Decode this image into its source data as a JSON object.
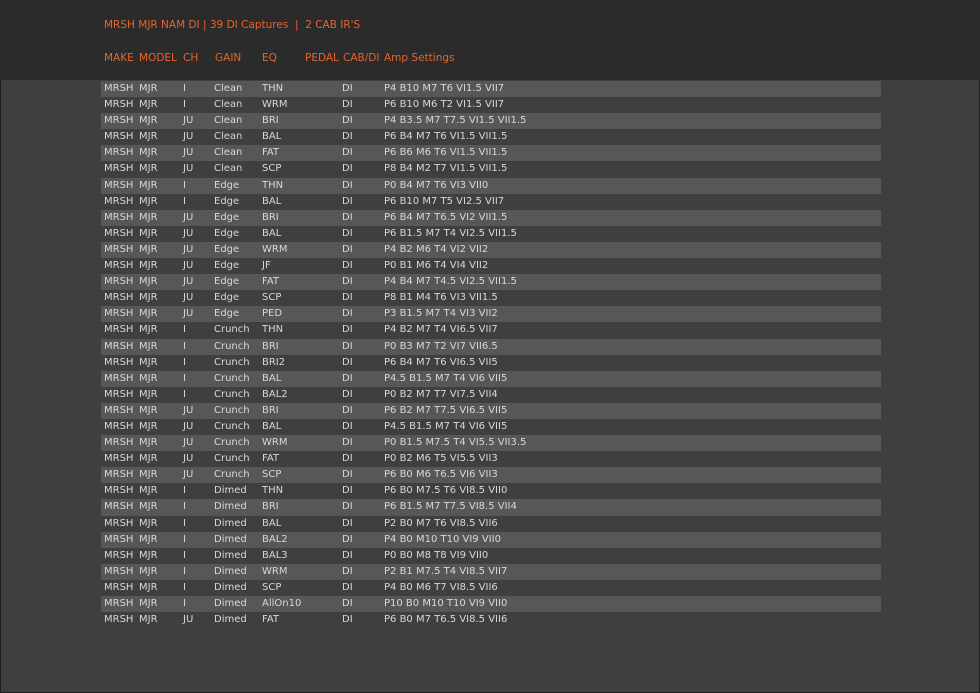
{
  "title": "MRSH MJR NAM DI | 39 DI Captures  |  2 CAB IR'S",
  "columns": {
    "make": "MAKE",
    "model": "MODEL",
    "ch": "CH",
    "gain": "GAIN",
    "eq": "EQ",
    "pedal": "PEDAL",
    "cab": "CAB/DI",
    "amp": "Amp Settings"
  },
  "rows": [
    {
      "make": "MRSH",
      "model": "MJR",
      "ch": "I",
      "gain": "Clean",
      "eq": "THN",
      "cab": "DI",
      "amp": "P4 B10 M7 T6 VI1.5 VII7"
    },
    {
      "make": "MRSH",
      "model": "MJR",
      "ch": "I",
      "gain": "Clean",
      "eq": "WRM",
      "cab": "DI",
      "amp": "P6 B10 M6 T2 VI1.5 VII7"
    },
    {
      "make": "MRSH",
      "model": "MJR",
      "ch": "JU",
      "gain": "Clean",
      "eq": "BRI",
      "cab": "DI",
      "amp": "P4 B3.5 M7 T7.5 VI1.5 VII1.5"
    },
    {
      "make": "MRSH",
      "model": "MJR",
      "ch": "JU",
      "gain": "Clean",
      "eq": "BAL",
      "cab": "DI",
      "amp": "P6 B4 M7 T6 VI1.5 VII1.5"
    },
    {
      "make": "MRSH",
      "model": "MJR",
      "ch": "JU",
      "gain": "Clean",
      "eq": "FAT",
      "cab": "DI",
      "amp": "P6 B6 M6 T6 VI1.5 VII1.5"
    },
    {
      "make": "MRSH",
      "model": "MJR",
      "ch": "JU",
      "gain": "Clean",
      "eq": "SCP",
      "cab": "DI",
      "amp": "P8 B4 M2 T7 VI1.5 VII1.5"
    },
    {
      "make": "MRSH",
      "model": "MJR",
      "ch": "I",
      "gain": "Edge",
      "eq": "THN",
      "cab": "DI",
      "amp": "P0 B4 M7 T6 VI3 VII0"
    },
    {
      "make": "MRSH",
      "model": "MJR",
      "ch": "I",
      "gain": "Edge",
      "eq": "BAL",
      "cab": "DI",
      "amp": "P6 B10 M7 T5 VI2.5 VII7"
    },
    {
      "make": "MRSH",
      "model": "MJR",
      "ch": "JU",
      "gain": "Edge",
      "eq": "BRI",
      "cab": "DI",
      "amp": "P6 B4 M7 T6.5 VI2 VII1.5"
    },
    {
      "make": "MRSH",
      "model": "MJR",
      "ch": "JU",
      "gain": "Edge",
      "eq": "BAL",
      "cab": "DI",
      "amp": "P6 B1.5 M7 T4 VI2.5 VII1.5"
    },
    {
      "make": "MRSH",
      "model": "MJR",
      "ch": "JU",
      "gain": "Edge",
      "eq": "WRM",
      "cab": "DI",
      "amp": "P4 B2 M6 T4 VI2 VII2"
    },
    {
      "make": "MRSH",
      "model": "MJR",
      "ch": "JU",
      "gain": "Edge",
      "eq": "JF",
      "cab": "DI",
      "amp": "P0 B1 M6 T4 VI4 VII2"
    },
    {
      "make": "MRSH",
      "model": "MJR",
      "ch": "JU",
      "gain": "Edge",
      "eq": "FAT",
      "cab": "DI",
      "amp": "P4 B4 M7 T4.5 VI2.5 VII1.5"
    },
    {
      "make": "MRSH",
      "model": "MJR",
      "ch": "JU",
      "gain": "Edge",
      "eq": "SCP",
      "cab": "DI",
      "amp": "P8 B1 M4 T6 VI3 VII1.5"
    },
    {
      "make": "MRSH",
      "model": "MJR",
      "ch": "JU",
      "gain": "Edge",
      "eq": "PED",
      "cab": "DI",
      "amp": "P3 B1.5 M7 T4 VI3 VII2"
    },
    {
      "make": "MRSH",
      "model": "MJR",
      "ch": "I",
      "gain": "Crunch",
      "eq": "THN",
      "cab": "DI",
      "amp": "P4 B2 M7 T4 VI6.5 VII7"
    },
    {
      "make": "MRSH",
      "model": "MJR",
      "ch": "I",
      "gain": "Crunch",
      "eq": "BRI",
      "cab": "DI",
      "amp": "P0 B3 M7 T2 VI7 VII6.5"
    },
    {
      "make": "MRSH",
      "model": "MJR",
      "ch": "I",
      "gain": "Crunch",
      "eq": "BRI2",
      "cab": "DI",
      "amp": "P6 B4 M7 T6 VI6.5 VII5"
    },
    {
      "make": "MRSH",
      "model": "MJR",
      "ch": "I",
      "gain": "Crunch",
      "eq": "BAL",
      "cab": "DI",
      "amp": "P4.5 B1.5 M7 T4 VI6 VII5"
    },
    {
      "make": "MRSH",
      "model": "MJR",
      "ch": "I",
      "gain": "Crunch",
      "eq": "BAL2",
      "cab": "DI",
      "amp": "P0 B2 M7 T7 VI7.5 VII4"
    },
    {
      "make": "MRSH",
      "model": "MJR",
      "ch": "JU",
      "gain": "Crunch",
      "eq": "BRI",
      "cab": "DI",
      "amp": "P6 B2 M7 T7.5 VI6.5 VII5"
    },
    {
      "make": "MRSH",
      "model": "MJR",
      "ch": "JU",
      "gain": "Crunch",
      "eq": "BAL",
      "cab": "DI",
      "amp": "P4.5 B1.5 M7 T4 VI6 VII5"
    },
    {
      "make": "MRSH",
      "model": "MJR",
      "ch": "JU",
      "gain": "Crunch",
      "eq": "WRM",
      "cab": "DI",
      "amp": "P0 B1.5 M7.5 T4 VI5.5 VII3.5"
    },
    {
      "make": "MRSH",
      "model": "MJR",
      "ch": "JU",
      "gain": "Crunch",
      "eq": "FAT",
      "cab": "DI",
      "amp": "P0 B2 M6 T5 VI5.5 VII3"
    },
    {
      "make": "MRSH",
      "model": "MJR",
      "ch": "JU",
      "gain": "Crunch",
      "eq": "SCP",
      "cab": "DI",
      "amp": "P6 B0 M6 T6.5 VI6 VII3"
    },
    {
      "make": "MRSH",
      "model": "MJR",
      "ch": "I",
      "gain": "Dimed",
      "eq": "THN",
      "cab": "DI",
      "amp": "P6 B0 M7.5 T6 VI8.5 VII0"
    },
    {
      "make": "MRSH",
      "model": "MJR",
      "ch": "I",
      "gain": "Dimed",
      "eq": "BRI",
      "cab": "DI",
      "amp": "P6 B1.5 M7 T7.5 VI8.5 VII4"
    },
    {
      "make": "MRSH",
      "model": "MJR",
      "ch": "I",
      "gain": "Dimed",
      "eq": "BAL",
      "cab": "DI",
      "amp": "P2 B0 M7 T6 VI8.5 VII6"
    },
    {
      "make": "MRSH",
      "model": "MJR",
      "ch": "I",
      "gain": "Dimed",
      "eq": "BAL2",
      "cab": "DI",
      "amp": "P4 B0 M10 T10 VI9 VII0"
    },
    {
      "make": "MRSH",
      "model": "MJR",
      "ch": "I",
      "gain": "Dimed",
      "eq": "BAL3",
      "cab": "DI",
      "amp": "P0 B0 M8 T8 VI9 VII0"
    },
    {
      "make": "MRSH",
      "model": "MJR",
      "ch": "I",
      "gain": "Dimed",
      "eq": "WRM",
      "cab": "DI",
      "amp": "P2 B1 M7.5 T4 VI8.5 VII7"
    },
    {
      "make": "MRSH",
      "model": "MJR",
      "ch": "I",
      "gain": "Dimed",
      "eq": "SCP",
      "cab": "DI",
      "amp": "P4 B0 M6 T7 VI8.5 VII6"
    },
    {
      "make": "MRSH",
      "model": "MJR",
      "ch": "I",
      "gain": "Dimed",
      "eq": "AllOn10",
      "cab": "DI",
      "amp": "P10 B0 M10 T10 VI9 VII0"
    },
    {
      "make": "MRSH",
      "model": "MJR",
      "ch": "JU",
      "gain": "Dimed",
      "eq": "FAT",
      "cab": "DI",
      "amp": "P6 B0 M7 T6.5 VI8.5 VII6"
    }
  ]
}
